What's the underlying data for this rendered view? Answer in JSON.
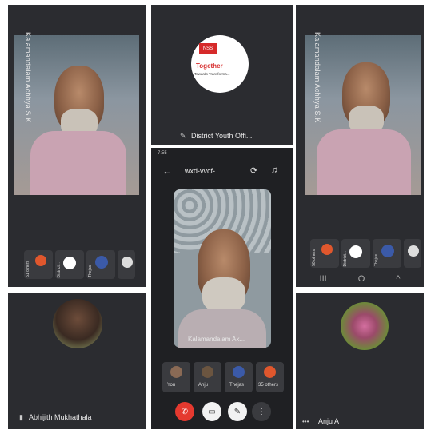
{
  "panels": {
    "top_left": {
      "speaker_name": "Kalamandalam Achhya S.K"
    },
    "top_center": {
      "tile_name": "District Youth Offi...",
      "logo_text_top": "NSS",
      "logo_text_main": "Together",
      "logo_text_sub": "Towards Transforma..."
    },
    "top_right": {
      "speaker_name": "Kalamandalam Achhya S.K"
    },
    "bottom_left": {
      "participant_name": "Abhijith Mukhathala"
    },
    "bottom_right": {
      "participant_name": "Anju A"
    }
  },
  "thumbs_left": [
    "51 others",
    "District...",
    "Thejas",
    ""
  ],
  "thumbs_right": [
    "50 others",
    "District...",
    "Thejas",
    ""
  ],
  "phone": {
    "status_time": "7:55",
    "meeting_code": "wxd-vvcf-...",
    "speaker_name": "Kalamandalam Ak...",
    "participants": [
      {
        "name": "You",
        "color": "#8a6a55"
      },
      {
        "name": "Anju",
        "color": "#6b5540"
      },
      {
        "name": "Thejas",
        "color": "#3b5aa8"
      },
      {
        "name": "35 others",
        "color": "#e0572d"
      }
    ]
  },
  "nav": {
    "back": "<",
    "home": "O",
    "recent": "III"
  },
  "colors": {
    "end_call": "#e5392f",
    "panel": "#2b2c30"
  }
}
